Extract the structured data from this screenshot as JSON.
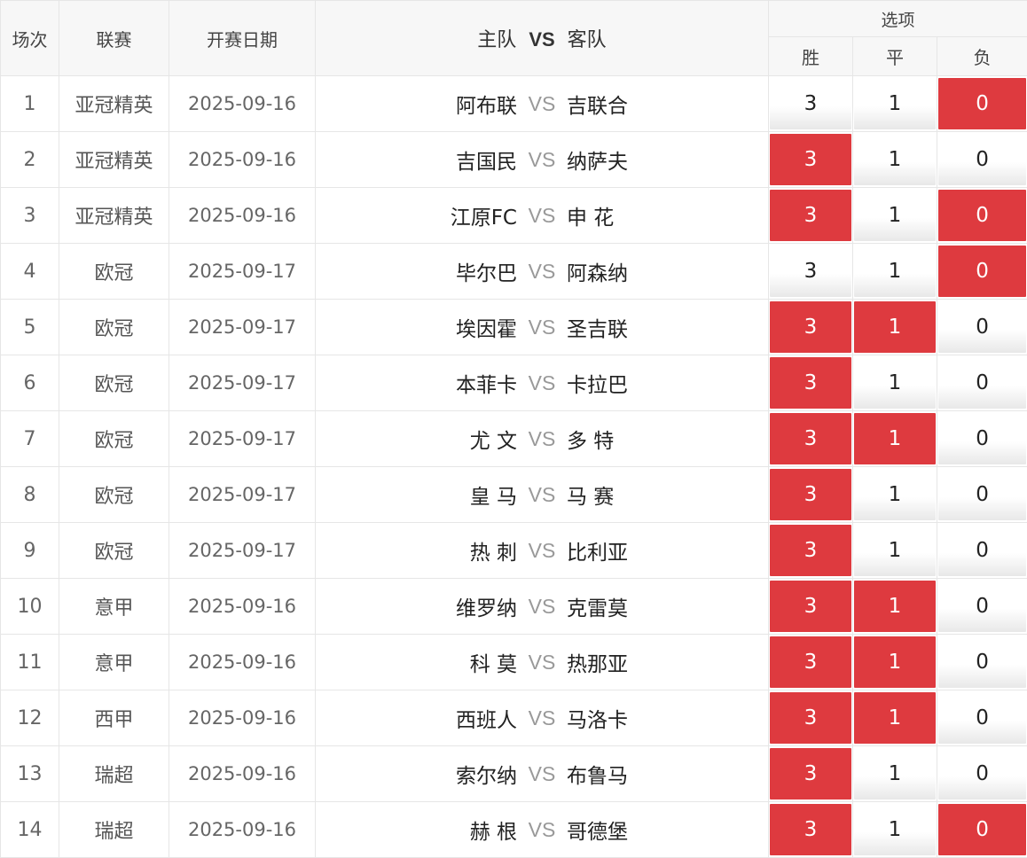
{
  "header": {
    "col_index": "场次",
    "col_league": "联赛",
    "col_date": "开赛日期",
    "col_home": "主队",
    "col_vs": "VS",
    "col_away": "客队",
    "col_options": "选项",
    "opt_win": "胜",
    "opt_draw": "平",
    "opt_lose": "负"
  },
  "vs_label": "VS",
  "colors": {
    "selected": "#de3a3f",
    "border": "#e6e6e6",
    "header_bg": "#f7f7f7"
  },
  "rows": [
    {
      "no": "1",
      "league": "亚冠精英",
      "date": "2025-09-16",
      "home": "阿布联",
      "away": "吉联合",
      "win": "3",
      "draw": "1",
      "lose": "0",
      "sel": [
        false,
        false,
        true
      ]
    },
    {
      "no": "2",
      "league": "亚冠精英",
      "date": "2025-09-16",
      "home": "吉国民",
      "away": "纳萨夫",
      "win": "3",
      "draw": "1",
      "lose": "0",
      "sel": [
        true,
        false,
        false
      ]
    },
    {
      "no": "3",
      "league": "亚冠精英",
      "date": "2025-09-16",
      "home": "江原FC",
      "away": "申 花",
      "win": "3",
      "draw": "1",
      "lose": "0",
      "sel": [
        true,
        false,
        true
      ]
    },
    {
      "no": "4",
      "league": "欧冠",
      "date": "2025-09-17",
      "home": "毕尔巴",
      "away": "阿森纳",
      "win": "3",
      "draw": "1",
      "lose": "0",
      "sel": [
        false,
        false,
        true
      ]
    },
    {
      "no": "5",
      "league": "欧冠",
      "date": "2025-09-17",
      "home": "埃因霍",
      "away": "圣吉联",
      "win": "3",
      "draw": "1",
      "lose": "0",
      "sel": [
        true,
        true,
        false
      ]
    },
    {
      "no": "6",
      "league": "欧冠",
      "date": "2025-09-17",
      "home": "本菲卡",
      "away": "卡拉巴",
      "win": "3",
      "draw": "1",
      "lose": "0",
      "sel": [
        true,
        false,
        false
      ]
    },
    {
      "no": "7",
      "league": "欧冠",
      "date": "2025-09-17",
      "home": "尤 文",
      "away": "多 特",
      "win": "3",
      "draw": "1",
      "lose": "0",
      "sel": [
        true,
        true,
        false
      ]
    },
    {
      "no": "8",
      "league": "欧冠",
      "date": "2025-09-17",
      "home": "皇 马",
      "away": "马 赛",
      "win": "3",
      "draw": "1",
      "lose": "0",
      "sel": [
        true,
        false,
        false
      ]
    },
    {
      "no": "9",
      "league": "欧冠",
      "date": "2025-09-17",
      "home": "热 刺",
      "away": "比利亚",
      "win": "3",
      "draw": "1",
      "lose": "0",
      "sel": [
        true,
        false,
        false
      ]
    },
    {
      "no": "10",
      "league": "意甲",
      "date": "2025-09-16",
      "home": "维罗纳",
      "away": "克雷莫",
      "win": "3",
      "draw": "1",
      "lose": "0",
      "sel": [
        true,
        true,
        false
      ]
    },
    {
      "no": "11",
      "league": "意甲",
      "date": "2025-09-16",
      "home": "科 莫",
      "away": "热那亚",
      "win": "3",
      "draw": "1",
      "lose": "0",
      "sel": [
        true,
        true,
        false
      ]
    },
    {
      "no": "12",
      "league": "西甲",
      "date": "2025-09-16",
      "home": "西班人",
      "away": "马洛卡",
      "win": "3",
      "draw": "1",
      "lose": "0",
      "sel": [
        true,
        true,
        false
      ]
    },
    {
      "no": "13",
      "league": "瑞超",
      "date": "2025-09-16",
      "home": "索尔纳",
      "away": "布鲁马",
      "win": "3",
      "draw": "1",
      "lose": "0",
      "sel": [
        true,
        false,
        false
      ]
    },
    {
      "no": "14",
      "league": "瑞超",
      "date": "2025-09-16",
      "home": "赫 根",
      "away": "哥德堡",
      "win": "3",
      "draw": "1",
      "lose": "0",
      "sel": [
        true,
        false,
        true
      ]
    }
  ]
}
